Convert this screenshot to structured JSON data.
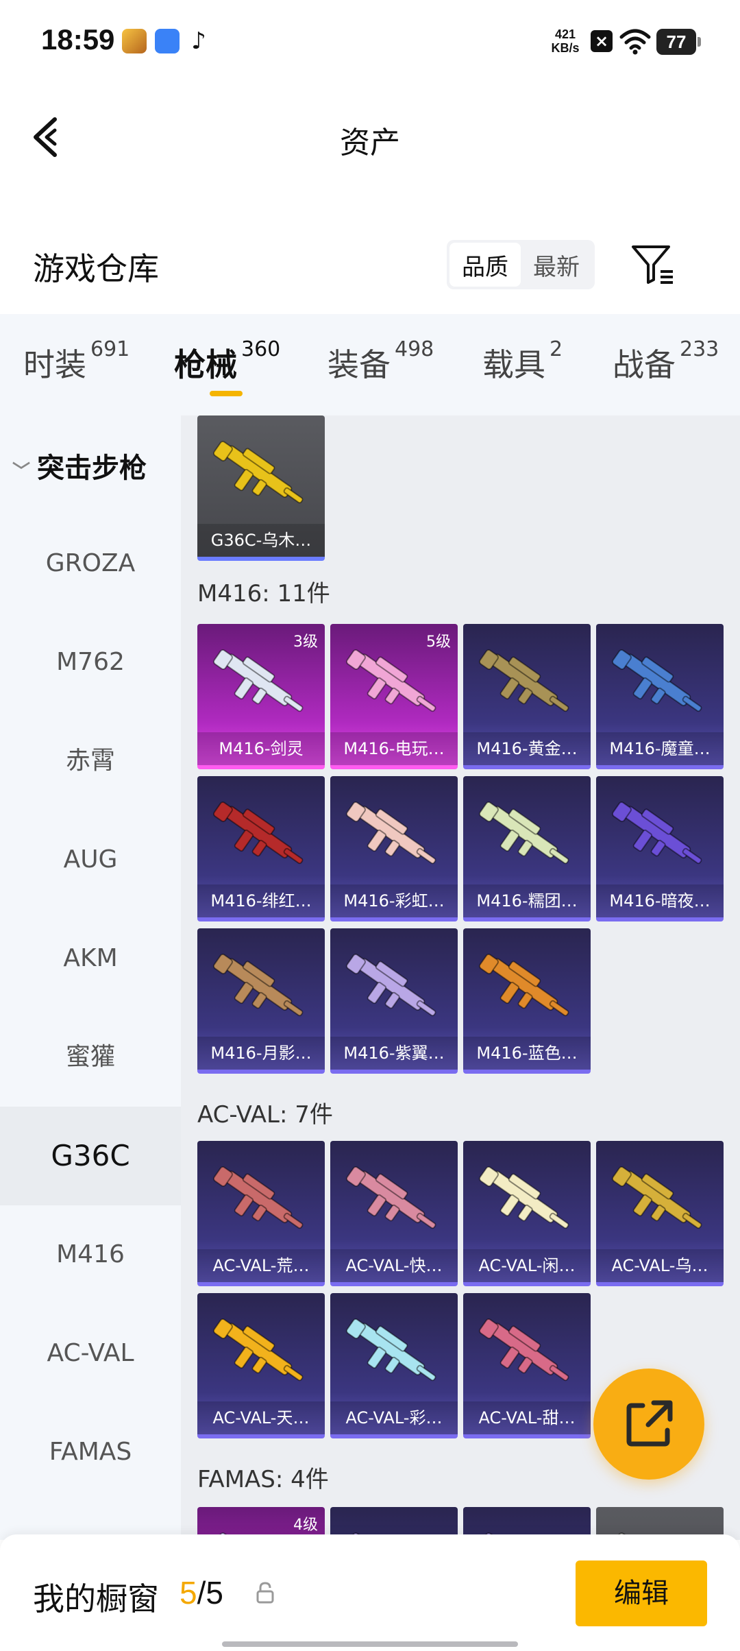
{
  "status_bar": {
    "time": "18:59",
    "net_speed_value": "421",
    "net_speed_unit": "KB/s",
    "battery": "77"
  },
  "header": {
    "title": "资产"
  },
  "warehouse": {
    "title": "游戏仓库",
    "sort_options": [
      {
        "label": "品质",
        "active": true
      },
      {
        "label": "最新",
        "active": false
      }
    ]
  },
  "tabs": [
    {
      "label": "时装",
      "count": "691",
      "active": false
    },
    {
      "label": "枪械",
      "count": "360",
      "active": true
    },
    {
      "label": "装备",
      "count": "498",
      "active": false
    },
    {
      "label": "载具",
      "count": "2",
      "active": false
    },
    {
      "label": "战备",
      "count": "233",
      "active": false
    }
  ],
  "subnav": {
    "category": "突击步枪",
    "items": [
      {
        "label": "GROZA",
        "active": false
      },
      {
        "label": "M762",
        "active": false
      },
      {
        "label": "赤霄",
        "active": false
      },
      {
        "label": "AUG",
        "active": false
      },
      {
        "label": "AKM",
        "active": false
      },
      {
        "label": "蜜獾",
        "active": false
      },
      {
        "label": "G36C",
        "active": true
      },
      {
        "label": "M416",
        "active": false
      },
      {
        "label": "AC-VAL",
        "active": false
      },
      {
        "label": "FAMAS",
        "active": false
      }
    ]
  },
  "groups": {
    "g36c": {
      "title": "",
      "items": [
        {
          "name": "G36C-乌木…",
          "rarity": "gray",
          "level": "",
          "color": "#e8c21a"
        }
      ]
    },
    "m416": {
      "title": "M416: 11件",
      "items": [
        {
          "name": "M416-剑灵",
          "rarity": "pink",
          "level": "3级",
          "color": "#dfe6f2"
        },
        {
          "name": "M416-电玩…",
          "rarity": "pink",
          "level": "5级",
          "color": "#f1a6d6"
        },
        {
          "name": "M416-黄金…",
          "rarity": "purple",
          "level": "",
          "color": "#a89256"
        },
        {
          "name": "M416-魔童…",
          "rarity": "purple",
          "level": "",
          "color": "#4a7fd0"
        },
        {
          "name": "M416-绯红…",
          "rarity": "purple",
          "level": "",
          "color": "#b52a2a"
        },
        {
          "name": "M416-彩虹…",
          "rarity": "purple",
          "level": "",
          "color": "#f0c8c0"
        },
        {
          "name": "M416-糯团…",
          "rarity": "purple",
          "level": "",
          "color": "#d9e6b8"
        },
        {
          "name": "M416-暗夜…",
          "rarity": "purple",
          "level": "",
          "color": "#6b4fd6"
        },
        {
          "name": "M416-月影…",
          "rarity": "purple",
          "level": "",
          "color": "#b88a5a"
        },
        {
          "name": "M416-紫翼…",
          "rarity": "purple",
          "level": "",
          "color": "#b9a7e6"
        },
        {
          "name": "M416-蓝色…",
          "rarity": "purple",
          "level": "",
          "color": "#e08a2a"
        }
      ]
    },
    "acval": {
      "title": "AC-VAL: 7件",
      "items": [
        {
          "name": "AC-VAL-荒…",
          "rarity": "purple",
          "level": "",
          "color": "#c96a6a"
        },
        {
          "name": "AC-VAL-快…",
          "rarity": "purple",
          "level": "",
          "color": "#d98aa0"
        },
        {
          "name": "AC-VAL-闲…",
          "rarity": "purple",
          "level": "",
          "color": "#f3ecc4"
        },
        {
          "name": "AC-VAL-乌…",
          "rarity": "purple",
          "level": "",
          "color": "#d6b03a"
        },
        {
          "name": "AC-VAL-天…",
          "rarity": "purple",
          "level": "",
          "color": "#f2b21c"
        },
        {
          "name": "AC-VAL-彩…",
          "rarity": "purple",
          "level": "",
          "color": "#a8e4f0"
        },
        {
          "name": "AC-VAL-甜…",
          "rarity": "purple",
          "level": "",
          "color": "#d86a88"
        }
      ]
    },
    "famas": {
      "title": "FAMAS: 4件",
      "items": [
        {
          "name": "",
          "rarity": "pink",
          "level": "4级",
          "color": "#cfc0ff"
        },
        {
          "name": "",
          "rarity": "purple",
          "level": "",
          "color": "#8a7ad0"
        },
        {
          "name": "",
          "rarity": "purple",
          "level": "",
          "color": "#8a7ad0"
        },
        {
          "name": "",
          "rarity": "gray",
          "level": "",
          "color": "#9a9a9a"
        }
      ]
    }
  },
  "bottom_bar": {
    "label": "我的橱窗",
    "count_current": "5",
    "count_sep": "/",
    "count_total": "5",
    "edit_label": "编辑"
  },
  "colors": {
    "accent": "#f9ad13",
    "highlight": "#f4a800",
    "pink_rarity": "#e24ce8",
    "purple_rarity": "#5d55b8"
  },
  "icons": [
    "back-arrow-icon",
    "filter-icon",
    "lock-icon",
    "share-icon",
    "wifi-icon"
  ]
}
